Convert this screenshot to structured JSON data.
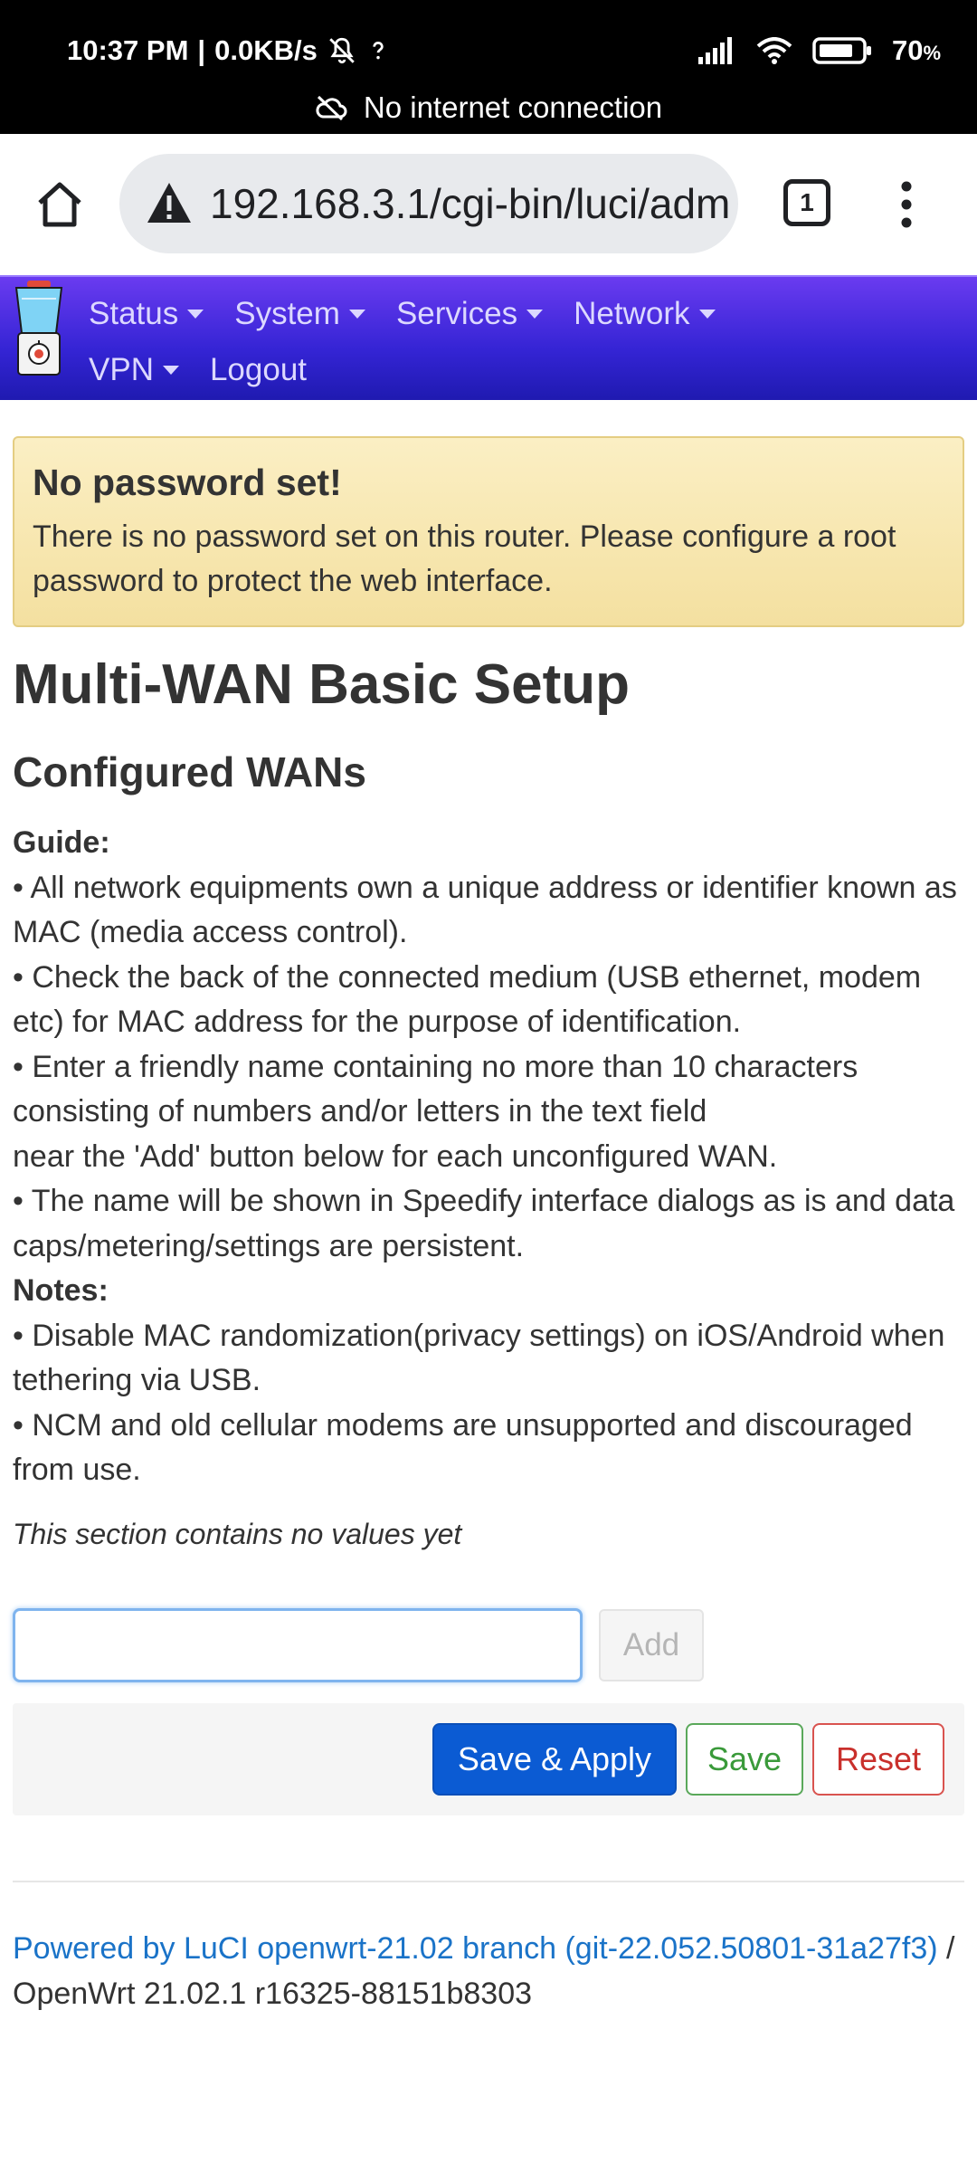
{
  "status_bar": {
    "time": "10:37 PM",
    "net_speed": "0.0KB/s",
    "battery": "70",
    "battery_unit": "%",
    "connection_notice": "No internet connection"
  },
  "browser": {
    "url": "192.168.3.1/cgi-bin/luci/adm",
    "tab_count": "1"
  },
  "nav": {
    "row1": [
      {
        "label": "Status"
      },
      {
        "label": "System"
      },
      {
        "label": "Services"
      },
      {
        "label": "Network"
      }
    ],
    "row2_vpn": "VPN",
    "row2_logout": "Logout"
  },
  "alert": {
    "title": "No password set!",
    "message": "There is no password set on this router. Please configure a root password to protect the web interface."
  },
  "page": {
    "title": "Multi-WAN Basic Setup",
    "section_title": "Configured WANs",
    "guide_heading": "Guide:",
    "guide_lines": [
      "• All network equipments own a unique address or identifier known as MAC (media access control).",
      "• Check the back of the connected medium (USB ethernet, modem etc) for MAC address for the purpose of identification.",
      "• Enter a friendly name containing no more than 10 characters consisting of numbers and/or letters in the text field",
      "near the 'Add' button below for each unconfigured WAN.",
      "• The name will be shown in Speedify interface dialogs as is and data caps/metering/settings are persistent."
    ],
    "notes_heading": "Notes:",
    "notes_lines": [
      "• Disable MAC randomization(privacy settings) on iOS/Android when tethering via USB.",
      "• NCM and old cellular modems are unsupported and discouraged from use."
    ],
    "no_values": "This section contains no values yet"
  },
  "form": {
    "name_input_value": "",
    "add_label": "Add",
    "save_apply_label": "Save & Apply",
    "save_label": "Save",
    "reset_label": "Reset"
  },
  "footer": {
    "link_text": "Powered by LuCI openwrt-21.02 branch (git-22.052.50801-31a27f3)",
    "version_text": " / OpenWrt 21.02.1 r16325-88151b8303"
  },
  "colors": {
    "header_gradient_top": "#6a3bf0",
    "header_gradient_bottom": "#1f1ab0",
    "alert_bg": "#fbefc4",
    "primary_button": "#0b5bd3",
    "save_button": "#3a9a3a",
    "reset_button": "#c9302c",
    "link": "#1a73c8"
  }
}
